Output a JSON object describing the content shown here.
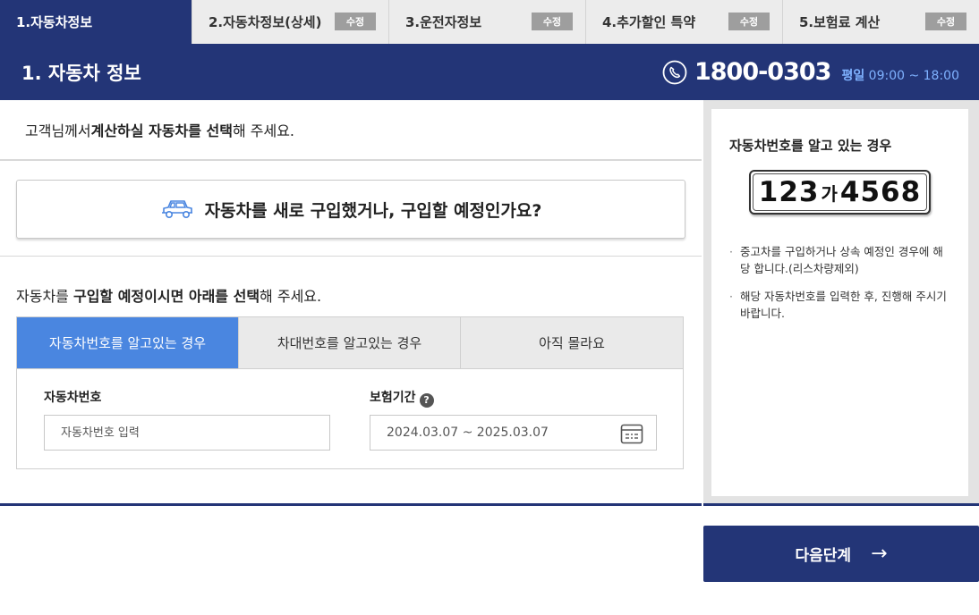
{
  "steps": [
    {
      "label": "1.자동차정보",
      "badge": ""
    },
    {
      "label": "2.자동차정보(상세)",
      "badge": "수정"
    },
    {
      "label": "3.운전자정보",
      "badge": "수정"
    },
    {
      "label": "4.추가할인 특약",
      "badge": "수정"
    },
    {
      "label": "5.보험료 계산",
      "badge": "수정"
    }
  ],
  "header": {
    "title": "1. 자동차 정보",
    "phone": "1800-0303",
    "hours_prefix": "평일",
    "hours": "09:00 ~ 18:00"
  },
  "intro": {
    "pre": "고객님께서 ",
    "bold": "계산하실 자동차를 선택",
    "post": "해 주세요."
  },
  "new_car_button": "자동차를 새로 구입했거나, 구입할 예정인가요?",
  "select_prompt": {
    "pre": "자동차를 ",
    "bold": "구입할 예정이시면 아래를 선택",
    "post": "해 주세요."
  },
  "option_tabs": [
    {
      "label": "자동차번호를 알고있는 경우",
      "active": true
    },
    {
      "label": "차대번호를 알고있는 경우",
      "active": false
    },
    {
      "label": "아직 몰라요",
      "active": false
    }
  ],
  "form": {
    "plate_label": "자동차번호",
    "plate_placeholder": "자동차번호 입력",
    "period_label": "보험기간",
    "period_help": "?",
    "period_value": "2024.03.07 ~ 2025.03.07"
  },
  "side": {
    "title": "자동차번호를 알고 있는 경우",
    "plate_num1": "123",
    "plate_kor": "가",
    "plate_num2": "4568",
    "notes": [
      "중고차를 구입하거나 상속 예정인 경우에 해당 합니다.(리스차량제외)",
      "해당 자동차번호를 입력한 후, 진행해 주시기 바랍니다."
    ]
  },
  "next_button": "다음단계",
  "next_arrow": "→",
  "colors": {
    "navy": "#233577",
    "accent_blue": "#4a86e0",
    "hours_blue": "#7fb2ff",
    "badge_gray": "#9e9e9e"
  }
}
